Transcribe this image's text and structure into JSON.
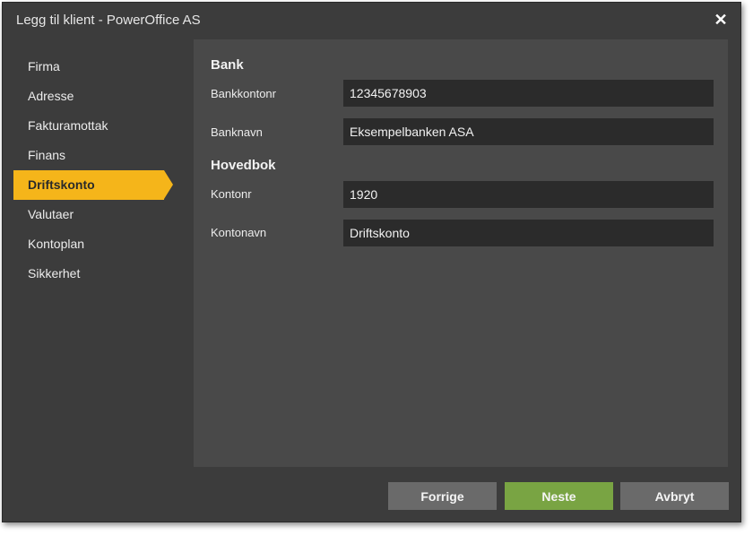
{
  "window": {
    "title": "Legg til klient - PowerOffice AS",
    "close_symbol": "✕"
  },
  "nav": {
    "items": [
      {
        "label": "Firma"
      },
      {
        "label": "Adresse"
      },
      {
        "label": "Fakturamottak"
      },
      {
        "label": "Finans"
      },
      {
        "label": "Driftskonto"
      },
      {
        "label": "Valutaer"
      },
      {
        "label": "Kontoplan"
      },
      {
        "label": "Sikkerhet"
      }
    ],
    "active_index": 4
  },
  "bank": {
    "heading": "Bank",
    "account_number_label": "Bankkontonr",
    "account_number_value": "12345678903",
    "bank_name_label": "Banknavn",
    "bank_name_value": "Eksempelbanken ASA"
  },
  "ledger": {
    "heading": "Hovedbok",
    "account_no_label": "Kontonr",
    "account_no_value": "1920",
    "account_name_label": "Kontonavn",
    "account_name_value": "Driftskonto"
  },
  "footer": {
    "previous_label": "Forrige",
    "next_label": "Neste",
    "cancel_label": "Avbryt"
  },
  "colors": {
    "accent": "#f5b51a",
    "next_button": "#79a443",
    "dialog_bg": "#3c3c3c",
    "panel_bg": "#494949",
    "input_bg": "#2b2b2b"
  }
}
